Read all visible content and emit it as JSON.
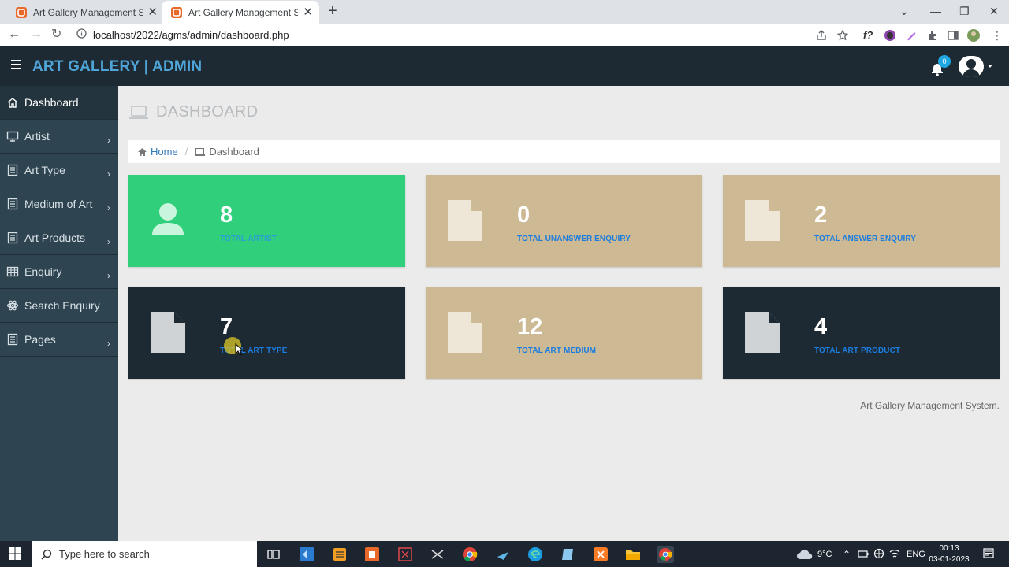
{
  "browser": {
    "tabs": [
      {
        "title": "Art Gallery Management System",
        "close": "✕"
      },
      {
        "title": "Art Gallery Management System",
        "close": "✕"
      }
    ],
    "new_tab": "+",
    "url": "localhost/2022/agms/admin/dashboard.php"
  },
  "header": {
    "brand": "ART GALLERY | ADMIN",
    "notification_count": "0"
  },
  "sidebar": {
    "items": [
      {
        "label": "Dashboard",
        "icon": "home-icon"
      },
      {
        "label": "Artist",
        "icon": "monitor-icon"
      },
      {
        "label": "Art Type",
        "icon": "file-icon"
      },
      {
        "label": "Medium of Art",
        "icon": "file-icon"
      },
      {
        "label": "Art Products",
        "icon": "file-icon"
      },
      {
        "label": "Enquiry",
        "icon": "table-icon"
      },
      {
        "label": "Search Enquiry",
        "icon": "atom-icon"
      },
      {
        "label": "Pages",
        "icon": "file-icon"
      }
    ],
    "arrow": "›"
  },
  "main": {
    "page_title": "DASHBOARD",
    "breadcrumb": {
      "home": "Home",
      "separator": "/",
      "current": "Dashboard"
    },
    "cards": [
      {
        "value": "8",
        "label": "TOTAL ARTIST",
        "color": "#2fcf7c",
        "icon": "user-icon"
      },
      {
        "value": "0",
        "label": "TOTAL UNANSWER ENQUIRY",
        "color": "#cdb994",
        "icon": "file-icon"
      },
      {
        "value": "2",
        "label": "TOTAL ANSWER ENQUIRY",
        "color": "#cdb994",
        "icon": "file-icon"
      },
      {
        "value": "7",
        "label": "TOTAL ART TYPE",
        "color": "#1e2a33",
        "icon": "file-icon"
      },
      {
        "value": "12",
        "label": "TOTAL ART MEDIUM",
        "color": "#cdb994",
        "icon": "file-icon"
      },
      {
        "value": "4",
        "label": "TOTAL ART PRODUCT",
        "color": "#1e2a33",
        "icon": "file-icon"
      }
    ],
    "footer": "Art Gallery Management System."
  },
  "taskbar": {
    "search_placeholder": "Type here to search",
    "weather": "9°C",
    "language": "ENG",
    "time": "00:13",
    "date": "03-01-2023"
  }
}
